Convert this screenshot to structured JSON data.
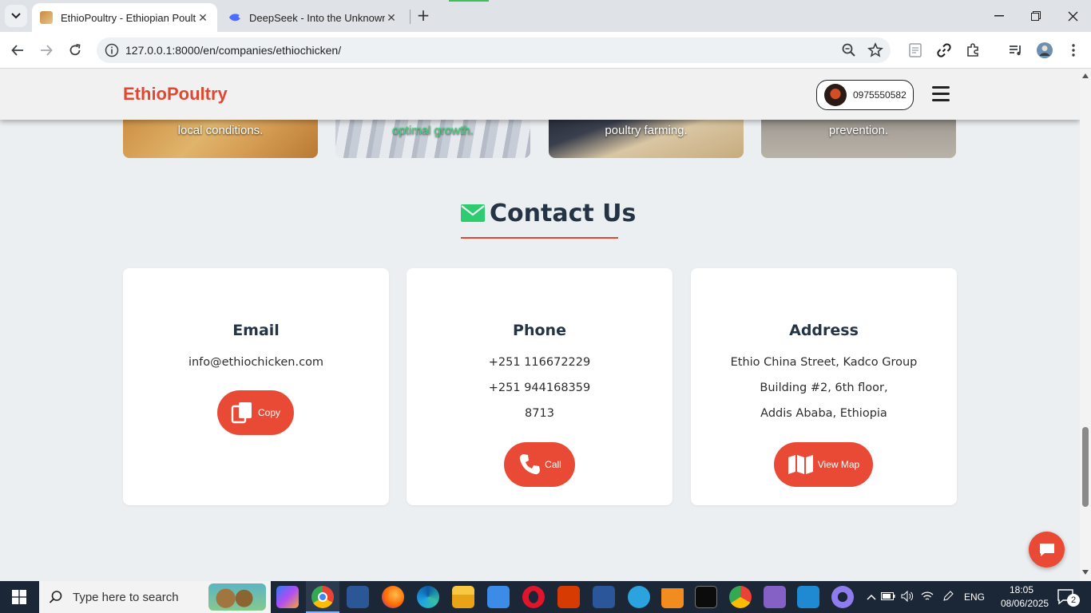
{
  "browser": {
    "tabs": [
      {
        "title": "EthioPoultry - Ethiopian Poultry",
        "active": true,
        "favicon": "ethiopoultry-favicon"
      },
      {
        "title": "DeepSeek - Into the Unknown",
        "active": false,
        "favicon": "deepseek-whale-icon"
      }
    ],
    "url": "127.0.0.1:8000/en/companies/ethiochicken/",
    "new_tab_label": "+"
  },
  "site": {
    "logo": "EthioPoultry",
    "phone": "0975550582",
    "feature_captions": [
      "local conditions.",
      "optimal growth.",
      "poultry farming.",
      "prevention."
    ],
    "contact_title": "Contact Us",
    "cards": {
      "email": {
        "title": "Email",
        "lines": [
          "info@ethiochicken.com"
        ],
        "button": "Copy"
      },
      "phone": {
        "title": "Phone",
        "lines": [
          "+251 116672229",
          "+251 944168359",
          "8713"
        ],
        "button": "Call"
      },
      "address": {
        "title": "Address",
        "lines": [
          "Ethio China Street, Kadco Group",
          "Building #2, 6th floor,",
          "Addis Ababa, Ethiopia"
        ],
        "button": "View Map"
      }
    },
    "accent_color": "#e84a36",
    "heading_color": "#253444"
  },
  "taskbar": {
    "search_placeholder": "Type here to search",
    "language": "ENG",
    "time": "18:05",
    "date": "08/06/2025",
    "notification_count": "2"
  }
}
